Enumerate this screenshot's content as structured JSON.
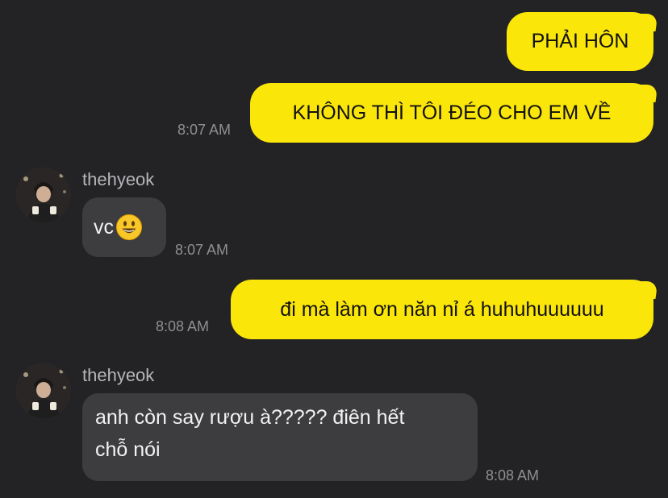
{
  "messages": [
    {
      "text": "PHẢI HÔN"
    },
    {
      "text": "KHÔNG THÌ TÔI ĐÉO CHO EM VỀ",
      "time": "8:07 AM"
    },
    {
      "sender": "thehyeok",
      "text": "vc",
      "emoji": "smiling-face-emoji",
      "time": "8:07 AM"
    },
    {
      "text": "đi mà làm ơn năn nỉ á huhuhuuuuuu",
      "time": "8:08 AM"
    },
    {
      "sender": "thehyeok",
      "text_line1": "anh còn say rượu à????? điên hết",
      "text_line2": "chỗ nói",
      "time": "8:08 AM"
    }
  ],
  "colors": {
    "background": "#232325",
    "outgoing_bubble": "#fbe60a",
    "incoming_bubble": "#3d3d40",
    "timestamp": "#8f8f93"
  }
}
